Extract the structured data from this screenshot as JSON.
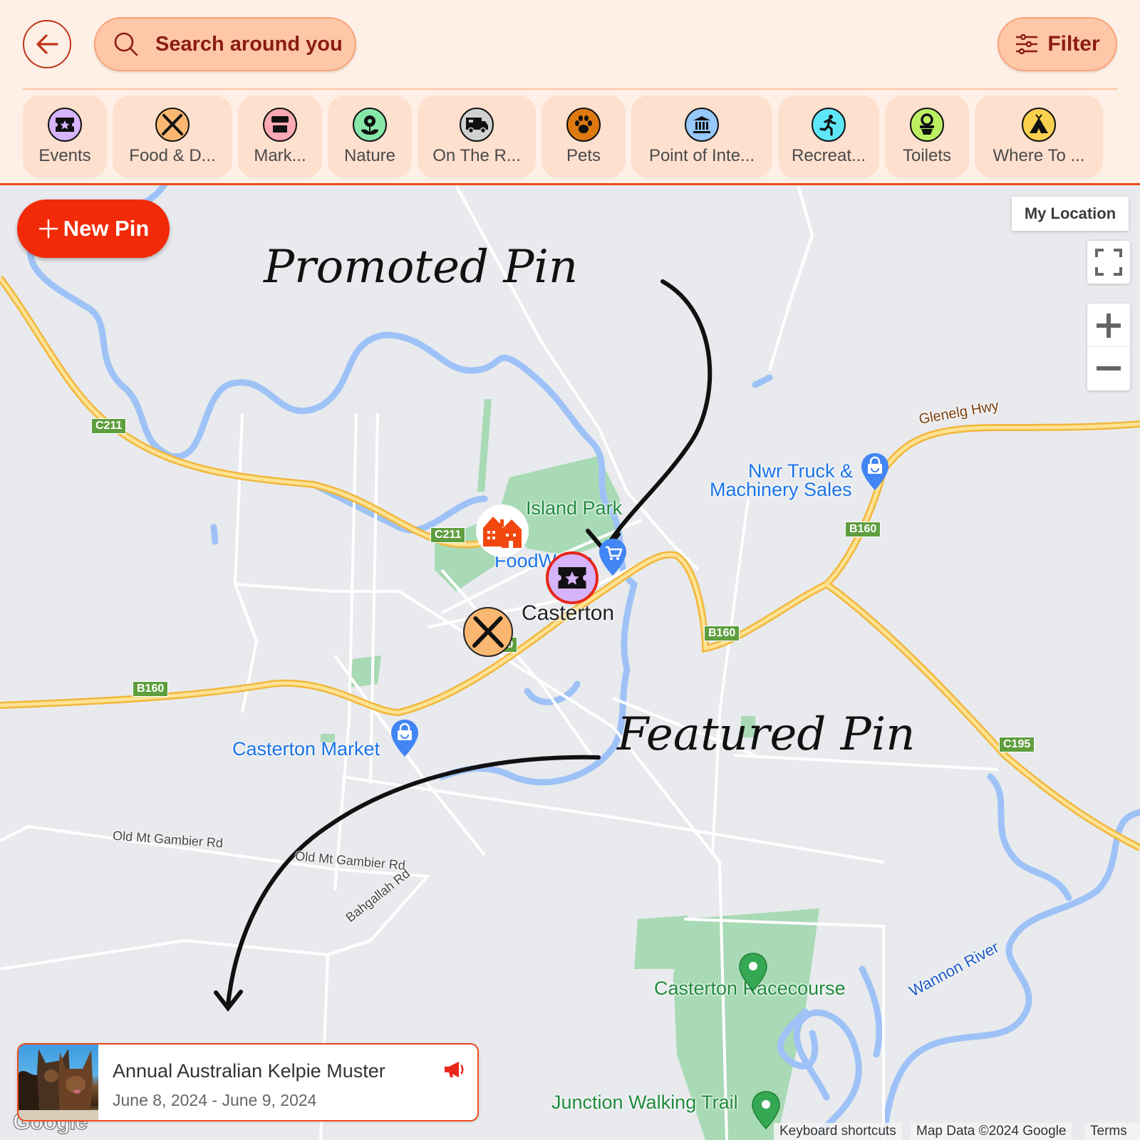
{
  "header": {
    "back_icon": "arrow-left-icon",
    "search": {
      "label": "Search around you",
      "icon": "search-icon"
    },
    "filter": {
      "label": "Filter",
      "icon": "sliders-icon"
    },
    "categories": [
      {
        "label": "Events",
        "icon": "ticket-star-icon",
        "color": "#d6b4fc"
      },
      {
        "label": "Food & D...",
        "icon": "knife-fork-icon",
        "color": "#fbb772"
      },
      {
        "label": "Mark...",
        "icon": "market-stall-icon",
        "color": "#f8a9b3"
      },
      {
        "label": "Nature",
        "icon": "flower-icon",
        "color": "#86e7a9"
      },
      {
        "label": "On The R...",
        "icon": "campervan-icon",
        "color": "#d0d2d1"
      },
      {
        "label": "Pets",
        "icon": "paw-icon",
        "color": "#de7a10"
      },
      {
        "label": "Point of Inte...",
        "icon": "museum-icon",
        "color": "#97c8fb"
      },
      {
        "label": "Recreat...",
        "icon": "running-icon",
        "color": "#5fe6f6"
      },
      {
        "label": "Toilets",
        "icon": "toilet-icon",
        "color": "#bdef63"
      },
      {
        "label": "Where To ...",
        "icon": "tent-icon",
        "color": "#fad14e"
      }
    ]
  },
  "map": {
    "new_pin_label": "New Pin",
    "my_location_label": "My Location",
    "controls": {
      "fullscreen": "fullscreen-icon",
      "zoom_in": "plus-icon",
      "zoom_out": "minus-icon"
    },
    "places": {
      "island_park": "Island Park",
      "foodworks": "FoodWorks",
      "casterton": "Casterton",
      "nwr_line1": "Nwr Truck &",
      "nwr_line2": "Machinery Sales",
      "market": "Casterton Market",
      "racecourse": "Casterton Racecourse",
      "walking_trail": "Junction Walking Trail",
      "wannon": "Wannon River",
      "glenelg": "Glenelg Hwy",
      "old_mt_1": "Old Mt Gambier Rd",
      "old_mt_2": "Old Mt Gambier Rd",
      "bahgallah": "Bahgallah Rd"
    },
    "shields": {
      "c211_a": "C211",
      "c211_b": "C211",
      "b160_a": "B160",
      "b160_b": "B160",
      "b160_c": "B160",
      "b160_d": "B160",
      "c195": "C195"
    },
    "annotations": {
      "promoted": "Promoted Pin",
      "featured": "Featured Pin"
    },
    "featured_card": {
      "title": "Annual Australian Kelpie Muster",
      "dates": "June 8, 2024 - June 9, 2024",
      "badge_icon": "megaphone-icon"
    },
    "attribution": {
      "keyboard": "Keyboard shortcuts",
      "data": "Map Data ©2024 Google",
      "terms": "Terms",
      "logo": "Google"
    }
  },
  "colors": {
    "accent": "#f22a08",
    "header_bg": "#fff0e7",
    "chip_bg": "#fee0cf",
    "pill_bg": "#fec7a8",
    "text_brand": "#8a1c10"
  }
}
